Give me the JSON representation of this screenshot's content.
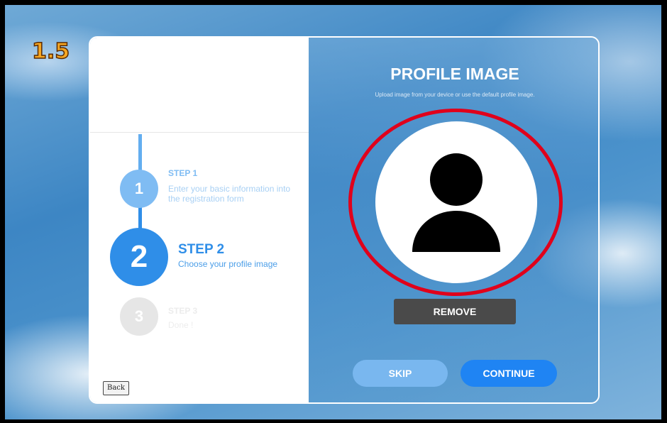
{
  "version_label": "1.5",
  "steps": [
    {
      "number": "1",
      "title": "STEP 1",
      "description": "Enter your basic information into the registration form",
      "state": "completed"
    },
    {
      "number": "2",
      "title": "STEP 2",
      "description": "Choose your profile image",
      "state": "active"
    },
    {
      "number": "3",
      "title": "STEP 3",
      "description": "Done !",
      "state": "pending"
    }
  ],
  "back_label": "Back",
  "profile": {
    "title": "PROFILE IMAGE",
    "subtitle": "Upload image from your device or use the default profile image.",
    "avatar_icon": "default-user-icon",
    "highlight_color": "#e0001b"
  },
  "buttons": {
    "remove": "REMOVE",
    "skip": "SKIP",
    "continue": "CONTINUE"
  },
  "colors": {
    "accent": "#2f8ee8",
    "continue": "#1f84f3",
    "skip": "#79b7ef",
    "remove": "#4a4a4a",
    "version": "#f5a623"
  }
}
